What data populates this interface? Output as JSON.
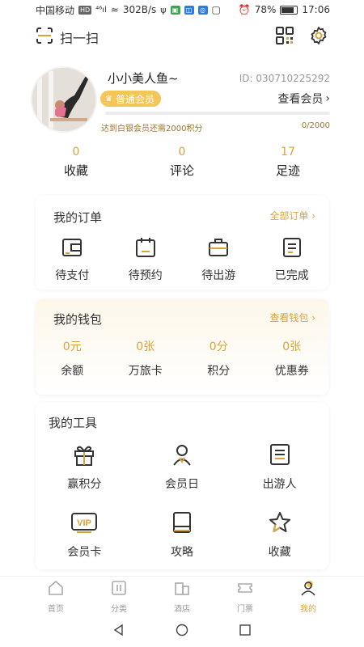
{
  "status": {
    "carrier": "中国移动",
    "network_chip": "HD",
    "signal_label": "⁴⁶ıl",
    "speed": "302B/s",
    "battery": "78%",
    "time": "17:06"
  },
  "top": {
    "scan_label": "扫一扫"
  },
  "profile": {
    "nickname": "小小美人鱼~",
    "id": "ID: 030710225292",
    "member_level": "普通会员",
    "view_member": "查看会员",
    "progress_text": "达到白银会员还需2000积分",
    "progress_count": "0/2000",
    "progress_fraction": 0
  },
  "stats": [
    {
      "value": "0",
      "label": "收藏"
    },
    {
      "value": "0",
      "label": "评论"
    },
    {
      "value": "17",
      "label": "足迹"
    }
  ],
  "orders": {
    "title": "我的订单",
    "link": "全部订单",
    "items": [
      {
        "label": "待支付",
        "icon": "wallet-icon"
      },
      {
        "label": "待预约",
        "icon": "calendar-icon"
      },
      {
        "label": "待出游",
        "icon": "suitcase-icon"
      },
      {
        "label": "已完成",
        "icon": "document-icon"
      }
    ]
  },
  "wallet": {
    "title": "我的钱包",
    "link": "查看钱包",
    "items": [
      {
        "value": "0元",
        "label": "余额"
      },
      {
        "value": "0张",
        "label": "万旅卡"
      },
      {
        "value": "0分",
        "label": "积分"
      },
      {
        "value": "0张",
        "label": "优惠券"
      }
    ]
  },
  "tools": {
    "title": "我的工具",
    "items": [
      {
        "label": "赢积分",
        "icon": "gift-icon"
      },
      {
        "label": "会员日",
        "icon": "member-day-icon"
      },
      {
        "label": "出游人",
        "icon": "traveler-list-icon"
      },
      {
        "label": "会员卡",
        "icon": "vip-card-icon",
        "text": "VIP"
      },
      {
        "label": "攻略",
        "icon": "guide-book-icon"
      },
      {
        "label": "收藏",
        "icon": "star-icon"
      }
    ]
  },
  "nav": [
    {
      "label": "首页",
      "icon": "home-icon"
    },
    {
      "label": "分类",
      "icon": "category-icon"
    },
    {
      "label": "酒店",
      "icon": "hotel-icon"
    },
    {
      "label": "门票",
      "icon": "ticket-icon"
    },
    {
      "label": "我的",
      "icon": "profile-icon",
      "active": true
    }
  ],
  "colors": {
    "accent": "#d9a33a",
    "badge": "#f4c558",
    "wallet_bg": "#fdf7ea"
  }
}
